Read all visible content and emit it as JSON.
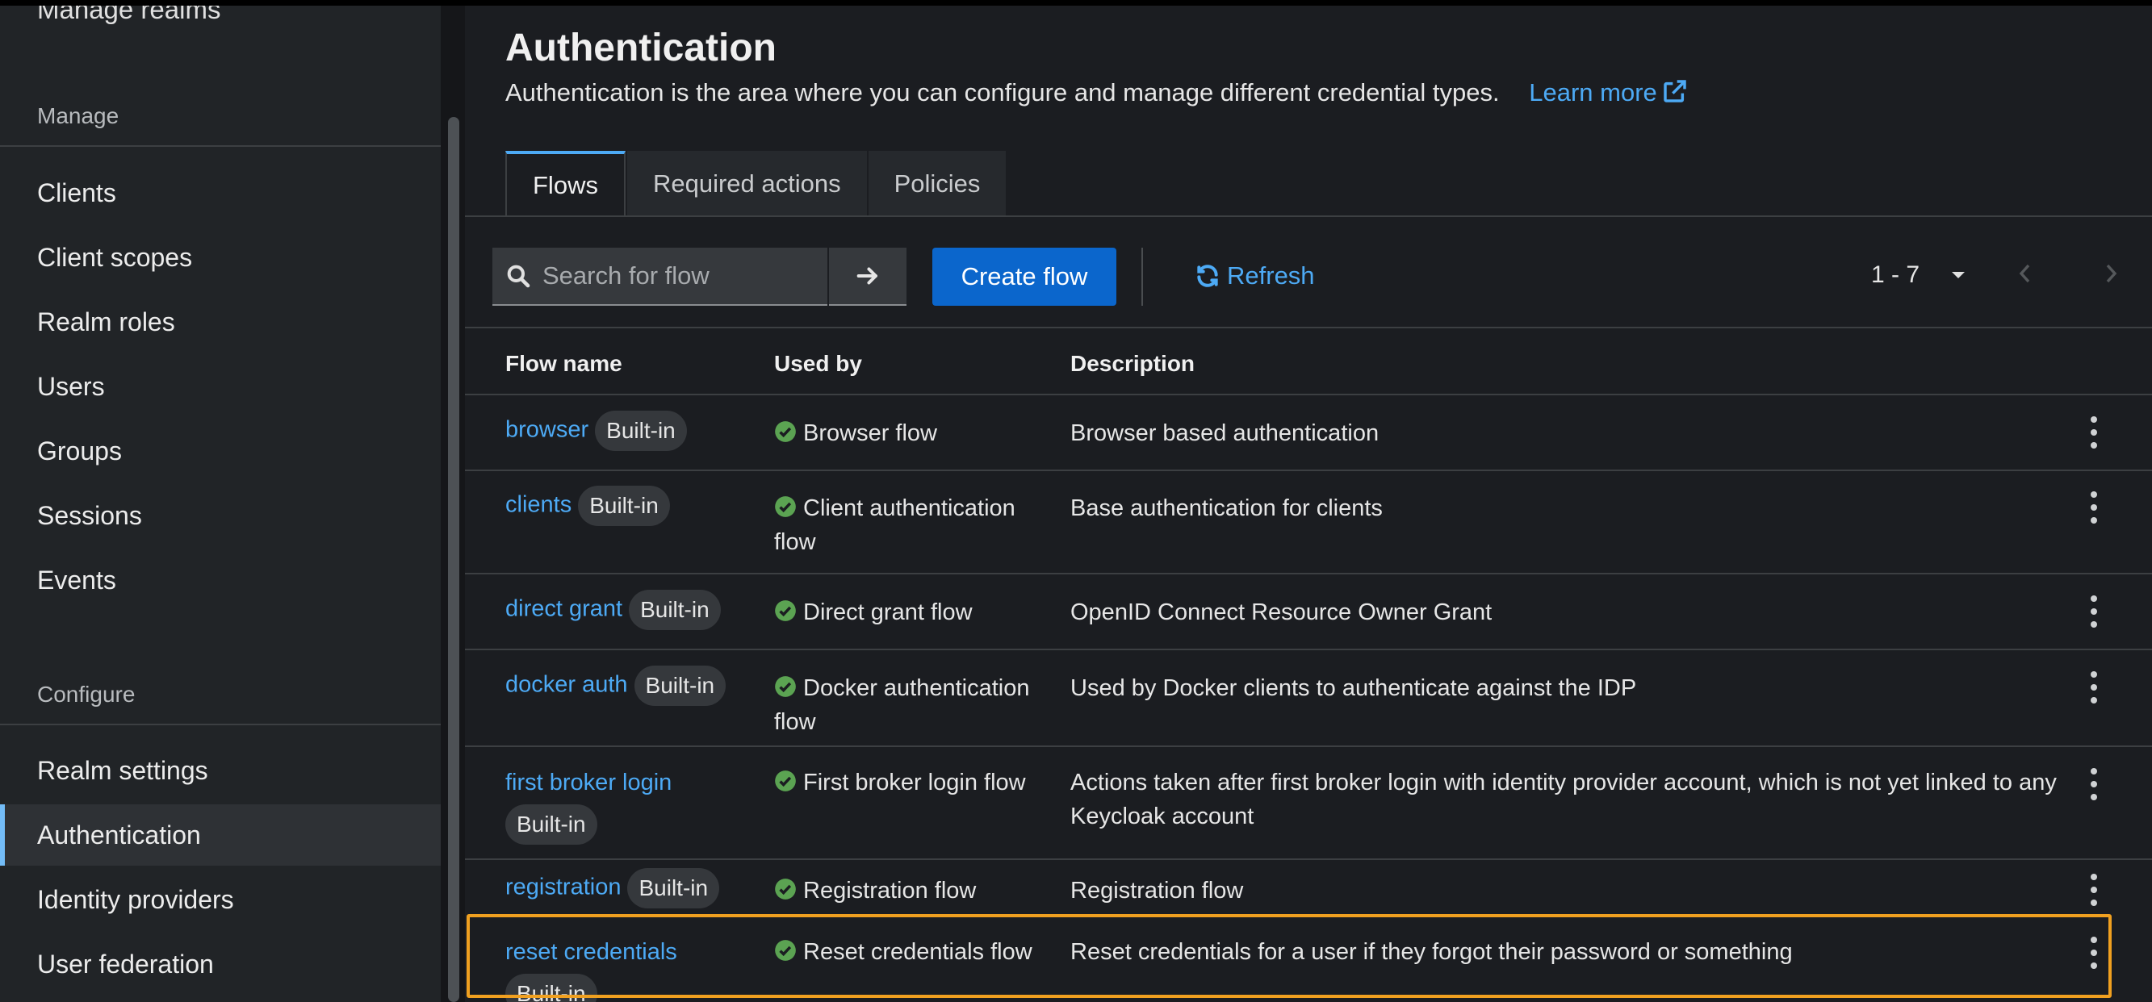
{
  "sidebar": {
    "cut_item": "Manage realms",
    "manage_title": "Manage",
    "manage_items": [
      "Clients",
      "Client scopes",
      "Realm roles",
      "Users",
      "Groups",
      "Sessions",
      "Events"
    ],
    "configure_title": "Configure",
    "configure_items": [
      "Realm settings",
      "Authentication",
      "Identity providers",
      "User federation"
    ],
    "active_item": "Authentication"
  },
  "page": {
    "title": "Authentication",
    "description": "Authentication is the area where you can configure and manage different credential types.",
    "learn_more": "Learn more"
  },
  "tabs": [
    "Flows",
    "Required actions",
    "Policies"
  ],
  "active_tab": "Flows",
  "toolbar": {
    "search_placeholder": "Search for flow",
    "create_label": "Create flow",
    "refresh_label": "Refresh",
    "pagination": "1 - 7"
  },
  "table": {
    "headers": [
      "Flow name",
      "Used by",
      "Description"
    ],
    "rows": [
      {
        "name": "browser",
        "badge": "Built-in",
        "used_by": "Browser flow",
        "description": "Browser based authentication"
      },
      {
        "name": "clients",
        "badge": "Built-in",
        "used_by": "Client authentication flow",
        "description": "Base authentication for clients"
      },
      {
        "name": "direct grant",
        "badge": "Built-in",
        "used_by": "Direct grant flow",
        "description": "OpenID Connect Resource Owner Grant"
      },
      {
        "name": "docker auth",
        "badge": "Built-in",
        "used_by": "Docker authentication flow",
        "description": "Used by Docker clients to authenticate against the IDP"
      },
      {
        "name": "first broker login",
        "badge": "Built-in",
        "used_by": "First broker login flow",
        "description": "Actions taken after first broker login with identity provider account, which is not yet linked to any Keycloak account"
      },
      {
        "name": "registration",
        "badge": "Built-in",
        "used_by": "Registration flow",
        "description": "Registration flow"
      },
      {
        "name": "reset credentials",
        "badge": "Built-in",
        "used_by": "Reset credentials flow",
        "description": "Reset credentials for a user if they forgot their password or something"
      }
    ]
  },
  "colors": {
    "accent": "#4daaf5",
    "primary_button": "#0b66cc",
    "success": "#3e8635",
    "highlight": "#f0a020"
  }
}
